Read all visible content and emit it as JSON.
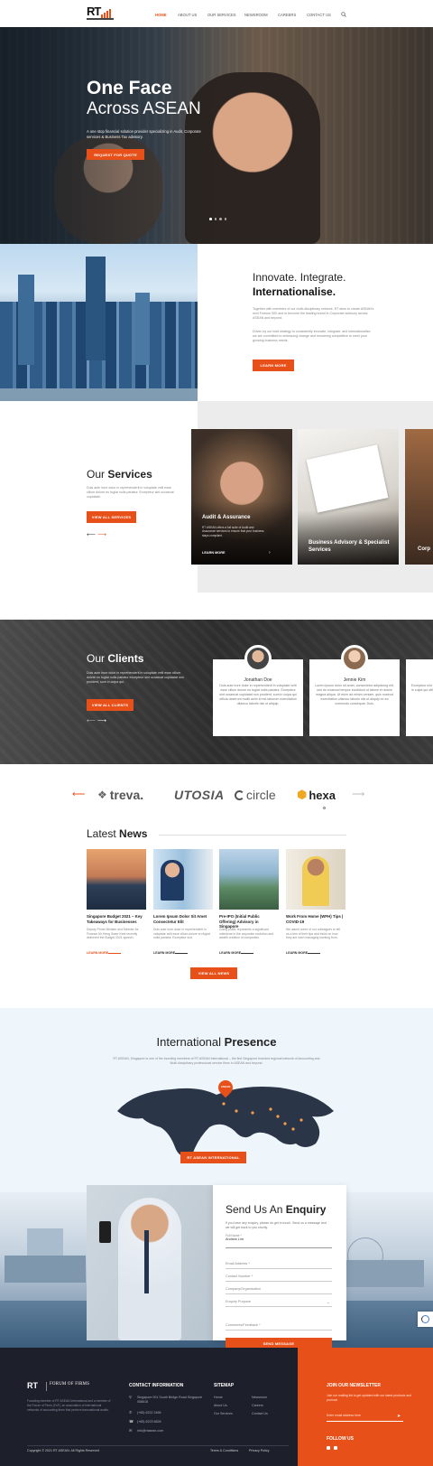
{
  "header": {
    "logo": "RT",
    "nav": [
      "HOME",
      "ABOUT US",
      "OUR SERVICES",
      "NEWSROOM",
      "CAREERS",
      "CONTACT US"
    ],
    "accent": "#e8501a"
  },
  "hero": {
    "title_bold": "One Face",
    "title_light": "Across ASEAN",
    "text": "A one stop financial solution provider specializing in Audit, Corporate services & Business Tax advisory.",
    "cta": "REQUEST FOR QUOTE"
  },
  "about": {
    "line1": "Innovate. Integrate.",
    "line2": "Internationalise.",
    "p1": "Together with members of our multi-disciplinary network, RT aims to create ASEAN's next Fortune 500 and to become the leading brand in Corporate advisory across ASEAN and beyond.",
    "p2": "Driven by our bold strategy to consistently innovate, integrate, and internationalise, we are committed to embracing change and remaining competitive to meet your growing business needs.",
    "cta": "LEARN MORE"
  },
  "services": {
    "title_light": "Our",
    "title_bold": "Services",
    "text": "Duis aute irure dolor in reprehenderit in voluptate velit esse cillum dolore eu fugiat nulla pariatur. Excepteur sint occaecat cupidatat.",
    "cta": "VIEW ALL SERVICES",
    "cards": [
      {
        "title": "Audit & Assurance",
        "text": "RT ASEAN offers a full suite of Audit and Assurance services to ensure that your business stays compliant.",
        "more": "LEARN MORE"
      },
      {
        "title": "Business Advisory & Specialist Services"
      },
      {
        "title": "Corp"
      }
    ]
  },
  "clients": {
    "title_light": "Our",
    "title_bold": "Clients",
    "text": "Duis aute irure dolor in reprehenderit in voluptate velit esse cillum dolore eu fugiat nulla pariatur excepteur sint occaecat cupidatat non proident, sunt in culpa qui.",
    "cta": "VIEW ALL CLIENTS",
    "cards": [
      {
        "name": "Jonathan Doe",
        "text": "Duis aute irure dolor in reprehenderit in voluptate velit esse cillum dolore eu fugiat nulla pariatur. Excepteur sint occaecat cupidatat non proident, sunt in culpa qui officia deserunt mollit anim id est laborum exercitation ullamco laboris nisi ut aliquip."
      },
      {
        "name": "Jennie Kim",
        "text": "Lorem ipsum dolor sit amet, consectetur adipiscing elit, sed do eiusmod tempor incididunt ut labore et dolore magna aliqua. Ut enim ad minim veniam, quis nostrud exercitation ullamco laboris nisi ut aliquip ex ea commodo consequat. Duis."
      },
      {
        "text": "Excepteur sint occaecat cupidatat non proident, sunt in culpa qui officia deserunt."
      }
    ]
  },
  "logos": [
    "treva.",
    "UTOSIA",
    "circle",
    "hexa"
  ],
  "news": {
    "title_light": "Latest",
    "title_bold": "News",
    "items": [
      {
        "title": "Singapore Budget 2021 – Key Takeaways for Businesses",
        "text": "Deputy Prime Minister and Minister for Finance Mr Heng Swee Keat recently delivered the Budget 2021 speech.",
        "more": "LEARN MORE"
      },
      {
        "title": "Lorem Ipsum Dolor Sit Amet Consectetur Elit",
        "text": "Duis aute irure dolor in reprehenderit in voluptate velit esse cillum dolore eu fugiat nulla pariatur. Excepteur sint.",
        "more": "LEARN MORE"
      },
      {
        "title": "Pre-IPO (Initial Public Offering) Advisory in Singapore",
        "text": "Going public represents a significant milestone in the corporate evolution and wealth creation of companies.",
        "more": "LEARN MORE"
      },
      {
        "title": "Work From Home (WFH) Tips | COVID-19",
        "text": "We asked some of our colleagues to tell us a few of their tips and tricks on how they are each managing working from.",
        "more": "LEARN MORE"
      }
    ],
    "cta": "VIEW ALL NEWS"
  },
  "presence": {
    "title_light": "International",
    "title_bold": "Presence",
    "text": "RT ASEAN, Singapore is one of the founding members of RT ASEAN International – the first Singapore branded regional network of Accounting and Multi-disciplinary professional service firms in ASEAN and beyond.",
    "pin": "ASEAN",
    "cta": "RT ASEAN INTERNATIONAL"
  },
  "enquiry": {
    "title_light": "Send Us An",
    "title_bold": "Enquiry",
    "text": "If you have any enquiry, please do get in touch. Send us a message and we will get back to you shortly.",
    "fields": [
      "Full Name *",
      "Email Address *",
      "Contact Number *",
      "Company/Organisation",
      "Enquiry Purpose",
      "Comments/Feedback *"
    ],
    "name_value": "Andrew Lim",
    "cta": "SEND MESSAGE"
  },
  "footer": {
    "brand2": "FORUM OF FIRMS",
    "about": "Founding member of RT ASEAN International and a member of the Forum of Firms (FoF), an association of international networks of accounting firms that perform transnational audits.",
    "contact_title": "CONTACT  INFORMATION",
    "address": "Singapore 001 South Bridge Road Singapore 058618",
    "phone": "(+65) 6222 2466",
    "fax": "(+65) 6223 6828",
    "email": "info@rtasean.com",
    "sitemap_title": "SITEMAP",
    "links": [
      "Home",
      "Newsroom",
      "About Us",
      "Careers",
      "Our Services",
      "Contact Us"
    ],
    "newsletter_title": "JOIN OUR NEWSLETTER",
    "newsletter_text": "Join our mailing list to get updated with our latest products and promos!",
    "newsletter_placeholder": "Enter email address here",
    "follow": "FOLLOW US",
    "copyright": "Copyright © 2021 RT ASEAN. All Rights Reserved",
    "terms": "Terms & Conditions",
    "privacy": "Privacy Policy"
  }
}
